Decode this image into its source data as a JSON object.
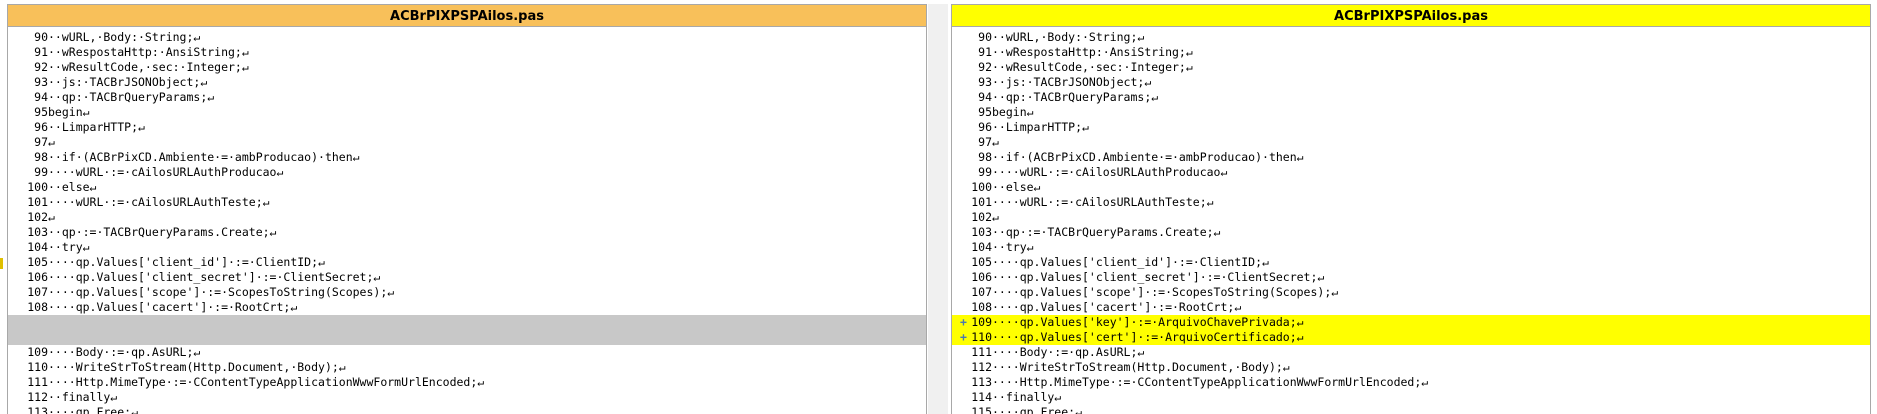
{
  "left": {
    "title": "ACBrPIXPSPAilos.pas",
    "lines": [
      {
        "num": "90",
        "text": "··wURL,·Body:·String;↵"
      },
      {
        "num": "91",
        "text": "··wRespostaHttp:·AnsiString;↵"
      },
      {
        "num": "92",
        "text": "··wResultCode,·sec:·Integer;↵"
      },
      {
        "num": "93",
        "text": "··js:·TACBrJSONObject;↵"
      },
      {
        "num": "94",
        "text": "··qp:·TACBrQueryParams;↵"
      },
      {
        "num": "95",
        "text": "begin↵"
      },
      {
        "num": "96",
        "text": "··LimparHTTP;↵"
      },
      {
        "num": "97",
        "text": "↵"
      },
      {
        "num": "98",
        "text": "··if·(ACBrPixCD.Ambiente·=·ambProducao)·then↵"
      },
      {
        "num": "99",
        "text": "····wURL·:=·cAilosURLAuthProducao↵"
      },
      {
        "num": "100",
        "text": "··else↵"
      },
      {
        "num": "101",
        "text": "····wURL·:=·cAilosURLAuthTeste;↵"
      },
      {
        "num": "102",
        "text": "↵"
      },
      {
        "num": "103",
        "text": "··qp·:=·TACBrQueryParams.Create;↵"
      },
      {
        "num": "104",
        "text": "··try↵"
      },
      {
        "num": "105",
        "text": "····qp.Values['client_id']·:=·ClientID;↵"
      },
      {
        "num": "106",
        "text": "····qp.Values['client_secret']·:=·ClientSecret;↵"
      },
      {
        "num": "107",
        "text": "····qp.Values['scope']·:=·ScopesToString(Scopes);↵"
      },
      {
        "num": "108",
        "text": "····qp.Values['cacert']·:=·RootCrt;↵"
      }
    ],
    "lines_after": [
      {
        "num": "109",
        "text": "····Body·:=·qp.AsURL;↵"
      },
      {
        "num": "110",
        "text": "····WriteStrToStream(Http.Document,·Body);↵"
      },
      {
        "num": "111",
        "text": "····Http.MimeType·:=·CContentTypeApplicationWwwFormUrlEncoded;↵"
      },
      {
        "num": "112",
        "text": "··finally↵"
      },
      {
        "num": "113",
        "text": "····qp.Free;↵"
      }
    ]
  },
  "right": {
    "title": "ACBrPIXPSPAilos.pas",
    "added_marker": "+",
    "lines": [
      {
        "num": "90",
        "text": "··wURL,·Body:·String;↵"
      },
      {
        "num": "91",
        "text": "··wRespostaHttp:·AnsiString;↵"
      },
      {
        "num": "92",
        "text": "··wResultCode,·sec:·Integer;↵"
      },
      {
        "num": "93",
        "text": "··js:·TACBrJSONObject;↵"
      },
      {
        "num": "94",
        "text": "··qp:·TACBrQueryParams;↵"
      },
      {
        "num": "95",
        "text": "begin↵"
      },
      {
        "num": "96",
        "text": "··LimparHTTP;↵"
      },
      {
        "num": "97",
        "text": "↵"
      },
      {
        "num": "98",
        "text": "··if·(ACBrPixCD.Ambiente·=·ambProducao)·then↵"
      },
      {
        "num": "99",
        "text": "····wURL·:=·cAilosURLAuthProducao↵"
      },
      {
        "num": "100",
        "text": "··else↵"
      },
      {
        "num": "101",
        "text": "····wURL·:=·cAilosURLAuthTeste;↵"
      },
      {
        "num": "102",
        "text": "↵"
      },
      {
        "num": "103",
        "text": "··qp·:=·TACBrQueryParams.Create;↵"
      },
      {
        "num": "104",
        "text": "··try↵"
      },
      {
        "num": "105",
        "text": "····qp.Values['client_id']·:=·ClientID;↵"
      },
      {
        "num": "106",
        "text": "····qp.Values['client_secret']·:=·ClientSecret;↵"
      },
      {
        "num": "107",
        "text": "····qp.Values['scope']·:=·ScopesToString(Scopes);↵"
      },
      {
        "num": "108",
        "text": "····qp.Values['cacert']·:=·RootCrt;↵"
      },
      {
        "num": "109",
        "text": "····qp.Values['key']·:=·ArquivoChavePrivada;↵",
        "added": true
      },
      {
        "num": "110",
        "text": "····qp.Values['cert']·:=·ArquivoCertificado;↵",
        "added": true
      },
      {
        "num": "111",
        "text": "····Body·:=·qp.AsURL;↵"
      },
      {
        "num": "112",
        "text": "····WriteStrToStream(Http.Document,·Body);↵"
      },
      {
        "num": "113",
        "text": "····Http.MimeType·:=·CContentTypeApplicationWwwFormUrlEncoded;↵"
      },
      {
        "num": "114",
        "text": "··finally↵"
      },
      {
        "num": "115",
        "text": "····qp.Free;↵"
      }
    ]
  },
  "colors": {
    "left_title_bg": "#f8c05a",
    "right_title_bg": "#ffff00",
    "added_line_bg": "#ffff00",
    "gap_bg": "#c8c8c8",
    "added_marker": "#4a78b0"
  }
}
